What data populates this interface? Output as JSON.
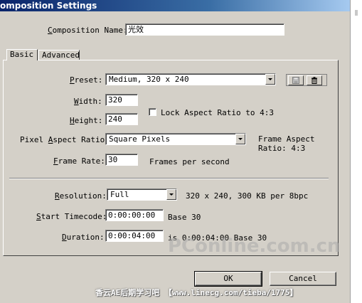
{
  "window": {
    "title": "omposition Settings"
  },
  "composition_name": {
    "label_pre": "",
    "label_ul": "C",
    "label_post": "omposition Name:",
    "value": "光效"
  },
  "tabs": [
    {
      "label": "Basic"
    },
    {
      "label": "Advanced"
    }
  ],
  "preset": {
    "label_ul": "P",
    "label_post": "reset:",
    "value": "Medium, 320 x 240"
  },
  "width": {
    "label_ul": "W",
    "label_post": "idth:",
    "value": "320"
  },
  "height": {
    "label_ul": "H",
    "label_post": "eight:",
    "value": "240"
  },
  "lock_aspect": {
    "label": "Lock Aspect Ratio to 4:3",
    "checked": false
  },
  "pixel_aspect": {
    "label_pre": "Pixel ",
    "label_ul": "A",
    "label_post": "spect Ratio:",
    "value": "Square Pixels"
  },
  "frame_aspect": {
    "line1": "Frame Aspect",
    "line2": "Ratio: 4:3"
  },
  "frame_rate": {
    "label_ul": "F",
    "label_post": "rame Rate:",
    "value": "30",
    "unit": "Frames per second"
  },
  "resolution": {
    "label_ul": "R",
    "label_post": "esolution:",
    "value": "Full",
    "info": "320 x 240, 300 KB per 8bpc"
  },
  "start_timecode": {
    "label_ul": "S",
    "label_post": "tart Timecode:",
    "value": "0:00:00:00",
    "base": "Base 30"
  },
  "duration": {
    "label_ul": "D",
    "label_post": "uration:",
    "value": "0:00:04:00",
    "info": "is 0:00:04:00  Base 30"
  },
  "buttons": {
    "ok": "OK",
    "cancel": "Cancel"
  },
  "watermark": {
    "logo": "PConline.com.cn",
    "footer": "香云AE后期学习吧  【www.linecg.com/tieba/1775】"
  },
  "colors": {
    "dialog_bg": "#d4d0c8",
    "title_bar": "#0a246a"
  }
}
